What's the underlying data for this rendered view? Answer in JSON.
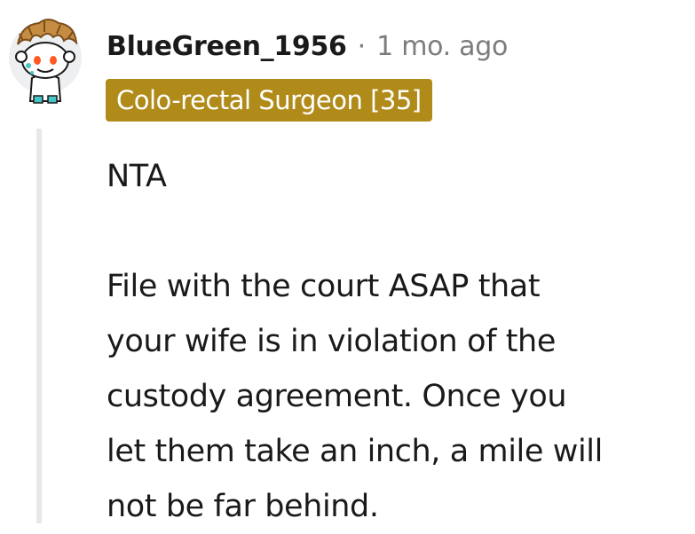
{
  "comment": {
    "username": "BlueGreen_1956",
    "separator": "·",
    "timestamp": "1 mo. ago",
    "flair": "Colo-rectal Surgeon [35]",
    "paragraphs": [
      {
        "lines": [
          "NTA"
        ]
      },
      {
        "lines": [
          "File with the court ASAP that",
          "your wife is in violation of the",
          "custody agreement. Once you",
          "let them take an inch, a mile will",
          "not be far behind."
        ]
      }
    ]
  },
  "colors": {
    "flair_bg": "#b08b1a",
    "flair_text": "#ffffff",
    "meta_gray": "#7c7c7c",
    "thread_line": "#e8e8e8",
    "text": "#1a1a1b"
  },
  "icons": {
    "avatar": "snoo-avatar-icon"
  }
}
